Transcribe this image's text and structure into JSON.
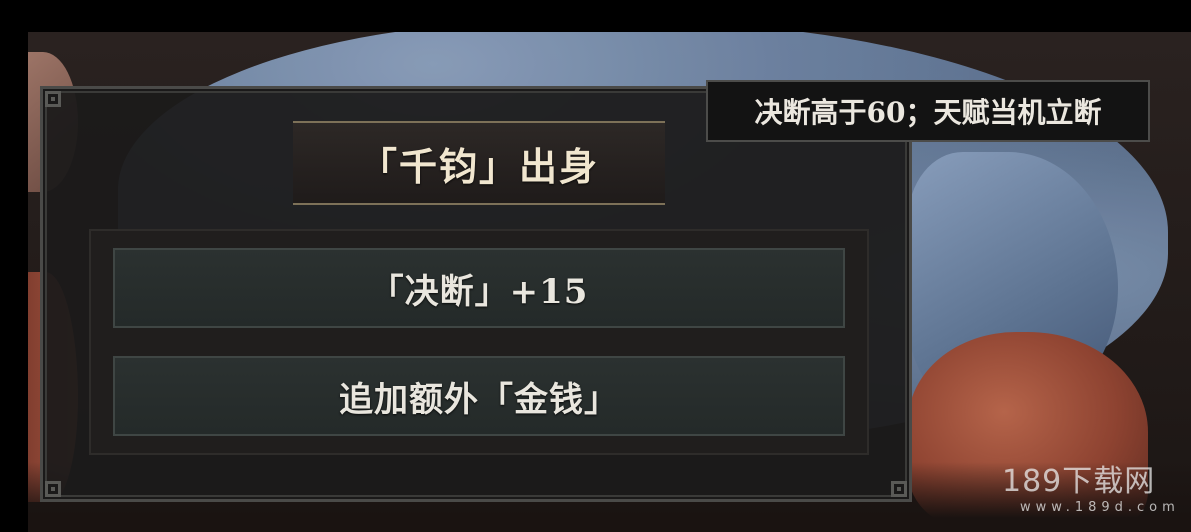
{
  "panel": {
    "title": "「千钧」出身",
    "options": [
      {
        "label": "「决断」+15"
      },
      {
        "label": "追加额外「金钱」"
      }
    ]
  },
  "tooltip": {
    "text": "决断高于60；天赋当机立断"
  },
  "watermark": {
    "main": "189下载网",
    "url": "www.189d.com"
  },
  "colors": {
    "panel_bg": "#1c1b1b",
    "title_text": "#f1e6cf",
    "option_bg": "#2b3130",
    "accent_gold": "#7d7158",
    "cloth_blue": "#6e84a4",
    "sleeve_red": "#8e4331"
  }
}
